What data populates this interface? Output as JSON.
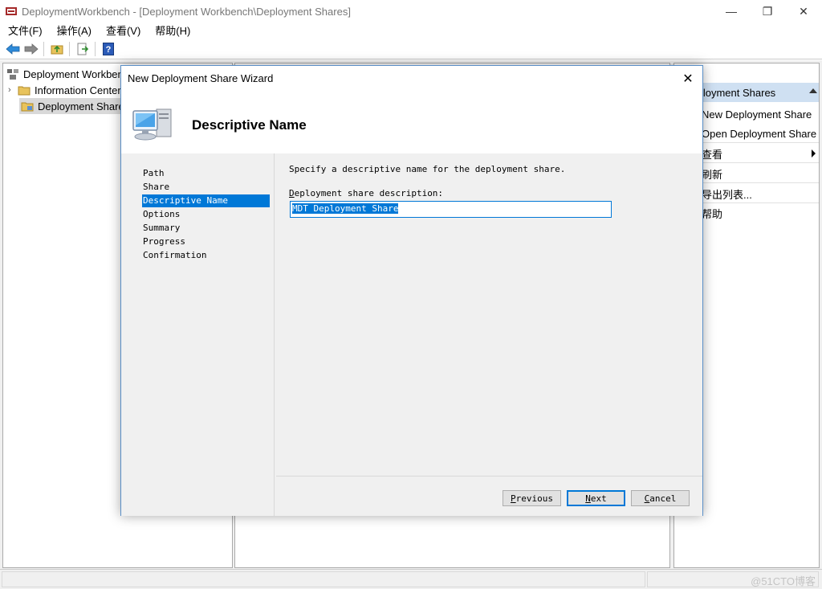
{
  "window": {
    "title": "DeploymentWorkbench - [Deployment Workbench\\Deployment Shares]",
    "controls": {
      "minimize": "—",
      "maximize": "❐",
      "close": "✕"
    }
  },
  "menu": [
    "文件(F)",
    "操作(A)",
    "查看(V)",
    "帮助(H)"
  ],
  "tree": {
    "root": "Deployment Workbench",
    "items": [
      "Information Center",
      "Deployment Shares"
    ],
    "selected": "Deployment Shares"
  },
  "actions": {
    "header": "Deployment Shares",
    "items": [
      "New Deployment Share",
      "Open Deployment Share",
      "查看",
      "刷新",
      "导出列表...",
      "帮助"
    ]
  },
  "status": {
    "watermark": "@51CTO博客"
  },
  "wizard": {
    "title": "New Deployment Share Wizard",
    "close": "✕",
    "heading": "Descriptive Name",
    "steps": [
      "Path",
      "Share",
      "Descriptive Name",
      "Options",
      "Summary",
      "Progress",
      "Confirmation"
    ],
    "active_step": "Descriptive Name",
    "instruction": "Specify a descriptive name for the deployment share.",
    "field_label_first": "D",
    "field_label_rest": "eployment share description:",
    "description_value": "MDT Deployment Share",
    "buttons": {
      "previous_first": "P",
      "previous_rest": "revious",
      "next_first": "N",
      "next_rest": "ext",
      "cancel_first": "C",
      "cancel_rest": "ancel"
    }
  },
  "colors": {
    "accent": "#0078d7",
    "actions_header": "#cfe0f2",
    "dialog_border": "#5a8fc7"
  }
}
